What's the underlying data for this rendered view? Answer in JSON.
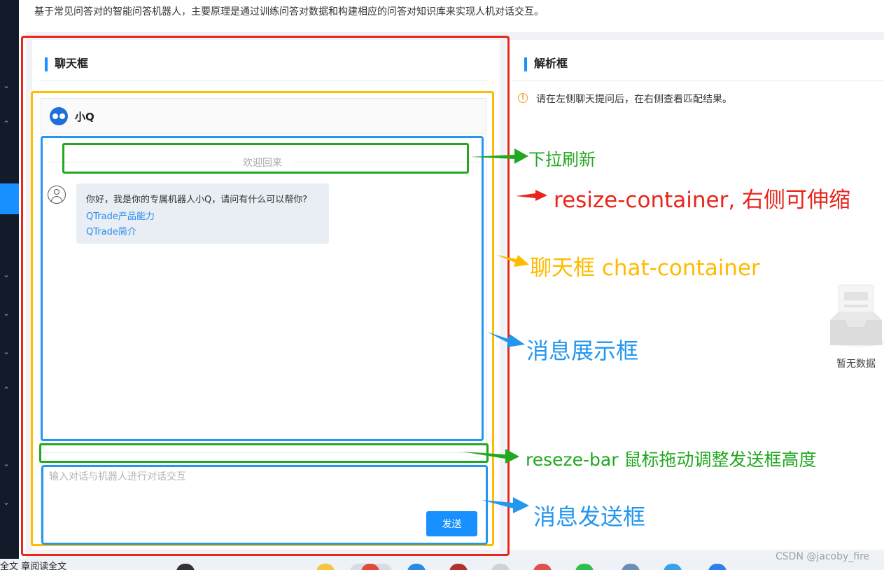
{
  "header": {
    "description": "基于常见问答对的智能问答机器人，主要原理是通过训练问答对数据和构建相应的问答对知识库来实现人机对话交互。"
  },
  "chat_panel": {
    "title": "聊天框",
    "bot_name": "小Q",
    "welcome": "欢迎回来",
    "bot_message": {
      "greeting": "你好，我是你的专属机器人小Q，请问有什么可以帮你?",
      "links": [
        "QTrade产品能力",
        "QTrade简介"
      ]
    },
    "input_placeholder": "输入对话与机器人进行对话交互",
    "send_label": "发送"
  },
  "parse_panel": {
    "title": "解析框",
    "tip": "请在左侧聊天提问后，在右侧查看匹配结果。",
    "empty_text": "暂无数据"
  },
  "annotations": {
    "refresh": "下拉刷新",
    "resize_container": "resize-container, 右侧可伸缩",
    "chat_container": "聊天框 chat-container",
    "message_display": "消息展示框",
    "resize_bar": "reseze-bar 鼠标拖动调整发送框高度",
    "message_send": "消息发送框"
  },
  "colors": {
    "accent": "#1890ff",
    "anno_red": "#e8261c",
    "anno_yellow": "#ffbb00",
    "anno_blue": "#2397f0",
    "anno_green": "#20a820"
  },
  "taskbar": {
    "partial_text": "全文 章阅读全文"
  },
  "watermark": "CSDN @jacoby_fire"
}
